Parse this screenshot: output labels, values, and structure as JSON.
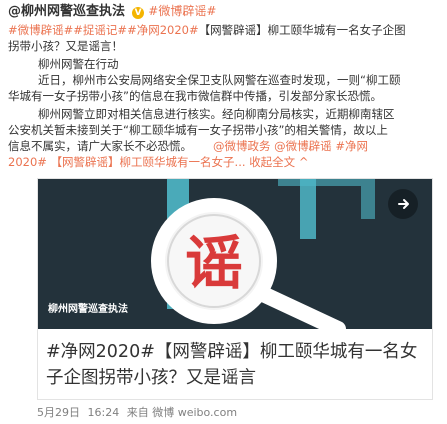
{
  "post": {
    "author": "@柳州网警巡查执法",
    "verified_mark": "V",
    "line1_tail": "#微博辟谣#",
    "line2_tags": [
      "#微博辟谣#",
      "#捉谣记#",
      "#净网2020#"
    ],
    "line2_text": "【网警辟谣】柳工颐华城有一名女子企图",
    "line3_text": "拐带小孩？又是谣言！",
    "line4_text": "柳州网警在行动",
    "line5_text": "近日，柳州市公安局网络安全保卫支队网警在巡查时发现，一则“柳工颐",
    "line6_text": "华城有一女子拐带小孩”的信息在我市微信群中传播，引发部分家长恐慌。",
    "line7_text": "柳州网警立即对相关信息进行核实。经向柳南分局核实，近期柳南辖区",
    "line8_text": "公安机关暂未接到关于“柳工颐华城有一女子拐带小孩”的相关警情，故以上",
    "line9_text": "信息不属实，请广大家长不必恐慌。",
    "line10_links": [
      "@微博政务",
      "@微博辟谣",
      "#净网"
    ],
    "line11_links": [
      "2020#",
      "【网警辟谣】柳工颐华城有一名女子...",
      "收起全文"
    ],
    "line11_suffix": "^"
  },
  "card": {
    "image_text": "谣",
    "watermark": "柳州网警巡查执法",
    "title_line1": "#净网2020#【网警辟谣】柳工颐华城有一名女",
    "title_line2": "子企图拐带小孩？又是谣言"
  },
  "footer": {
    "date": "5月29日",
    "time": "16:24",
    "source_prefix": "来自",
    "source": "微博 weibo.com"
  },
  "colors": {
    "link": "#eb7350",
    "image_bg": "#23323b",
    "seal_red": "#d93a3a",
    "lens_ring": "#ffffff"
  }
}
